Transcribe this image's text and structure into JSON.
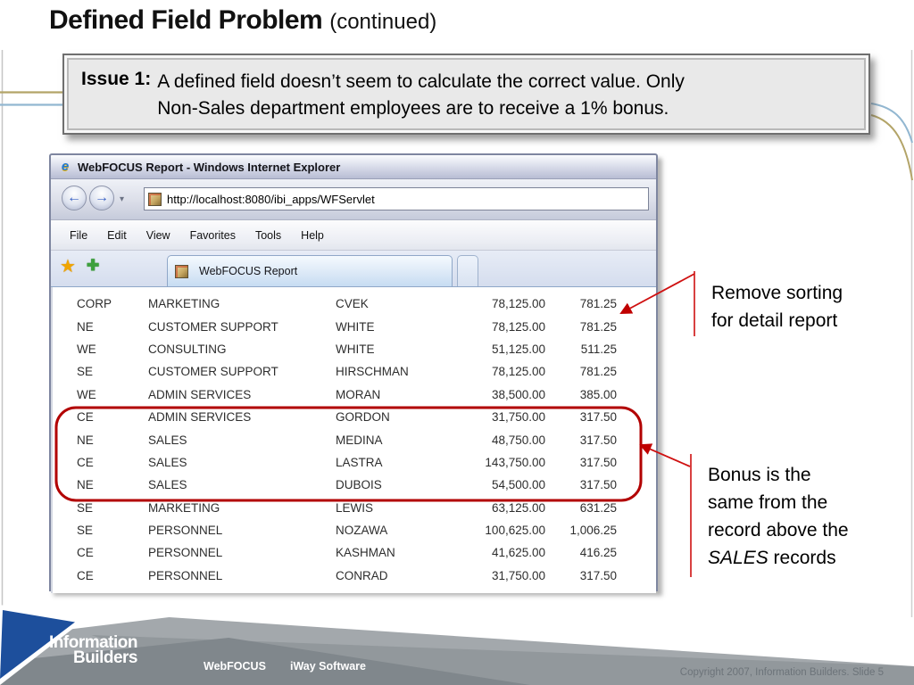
{
  "slide": {
    "title": "Defined Field Problem",
    "title_suffix": "(continued)",
    "issue": {
      "label": "Issue 1:",
      "line1": "A defined field doesn’t seem to calculate the correct value. Only",
      "line2": "Non-Sales department employees are to receive a 1% bonus."
    },
    "notes": {
      "note1_line1": "Remove sorting",
      "note1_line2": "for detail report",
      "note2_line1": "Bonus is the",
      "note2_line2": "same from the",
      "note2_line3": "record above the",
      "note2_line4_italic": "SALES",
      "note2_line4_rest": " records"
    }
  },
  "browser": {
    "window_title": "WebFOCUS Report - Windows Internet Explorer",
    "url": "http://localhost:8080/ibi_apps/WFServlet",
    "menu": [
      "File",
      "Edit",
      "View",
      "Favorites",
      "Tools",
      "Help"
    ],
    "tab_label": "WebFOCUS Report",
    "icons": {
      "ie_logo": "e",
      "back": "←",
      "forward": "→",
      "dropdown": "▾",
      "favorites_star": "★",
      "add_favorite": "✚"
    }
  },
  "report": {
    "rows": [
      [
        "CORP",
        "MARKETING",
        "CVEK",
        "78,125.00",
        "781.25"
      ],
      [
        "NE",
        "CUSTOMER SUPPORT",
        "WHITE",
        "78,125.00",
        "781.25"
      ],
      [
        "WE",
        "CONSULTING",
        "WHITE",
        "51,125.00",
        "511.25"
      ],
      [
        "SE",
        "CUSTOMER SUPPORT",
        "HIRSCHMAN",
        "78,125.00",
        "781.25"
      ],
      [
        "WE",
        "ADMIN SERVICES",
        "MORAN",
        "38,500.00",
        "385.00"
      ],
      [
        "CE",
        "ADMIN SERVICES",
        "GORDON",
        "31,750.00",
        "317.50"
      ],
      [
        "NE",
        "SALES",
        "MEDINA",
        "48,750.00",
        "317.50"
      ],
      [
        "CE",
        "SALES",
        "LASTRA",
        "143,750.00",
        "317.50"
      ],
      [
        "NE",
        "SALES",
        "DUBOIS",
        "54,500.00",
        "317.50"
      ],
      [
        "SE",
        "MARKETING",
        "LEWIS",
        "63,125.00",
        "631.25"
      ],
      [
        "SE",
        "PERSONNEL",
        "NOZAWA",
        "100,625.00",
        "1,006.25"
      ],
      [
        "CE",
        "PERSONNEL",
        "KASHMAN",
        "41,625.00",
        "416.25"
      ],
      [
        "CE",
        "PERSONNEL",
        "CONRAD",
        "31,750.00",
        "317.50"
      ]
    ]
  },
  "footer": {
    "logo_line1": "Information",
    "logo_line2": "Builders",
    "brand1": "WebFOCUS",
    "brand2": "iWay Software",
    "copyright": "Copyright 2007, Information Builders. Slide 5"
  },
  "colors": {
    "annotation_red": "#c00000",
    "highlight_red": "#b20000",
    "footer_blue": "#1d4f9c",
    "footer_gray": "#a3a8ac",
    "line_olive": "#b3a468",
    "line_blue": "#92b7d1"
  }
}
